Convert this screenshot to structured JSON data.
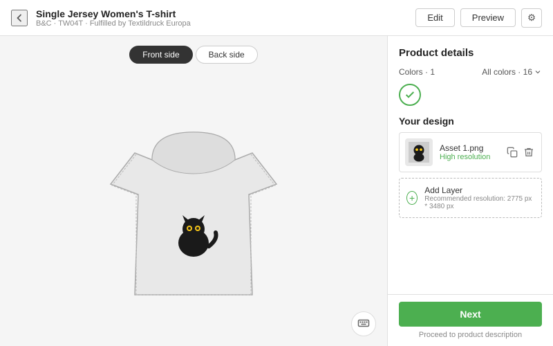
{
  "header": {
    "back_label": "←",
    "title": "Single Jersey Women's T-shirt",
    "subtitle": "B&C · TW04T · Fulfilled by Textildruck Europa",
    "edit_label": "Edit",
    "preview_label": "Preview",
    "settings_icon": "⚙"
  },
  "canvas": {
    "front_side_label": "Front side",
    "back_side_label": "Back side"
  },
  "right_panel": {
    "product_details_title": "Product details",
    "colors_label": "Colors · 1",
    "all_colors_label": "All colors · 16",
    "your_design_title": "Your design",
    "asset_name": "Asset 1.png",
    "asset_status": "High resolution",
    "add_layer_label": "Add Layer",
    "add_layer_hint": "Recommended resolution: 2775 px * 3480 px",
    "next_label": "Next",
    "footer_hint": "Proceed to product description"
  }
}
